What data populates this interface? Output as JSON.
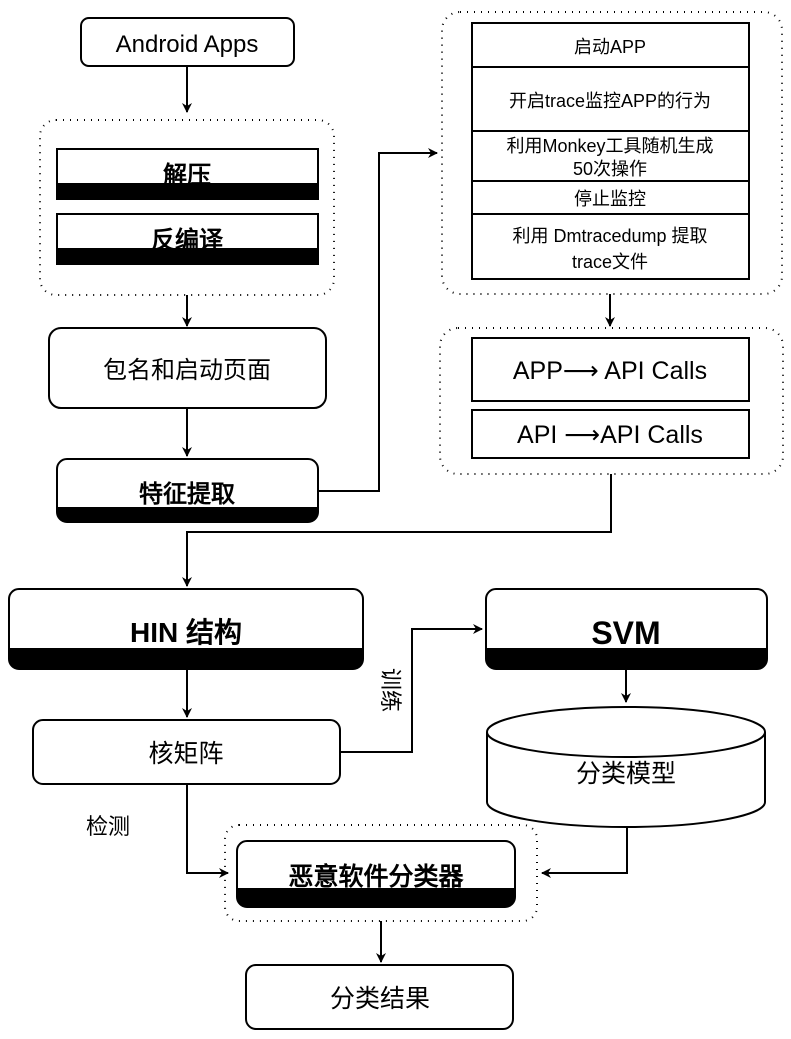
{
  "nodes": {
    "android_apps": "Android Apps",
    "unzip": "解压",
    "decompile": "反编译",
    "package_launch": "包名和启动页面",
    "feature_extract": "特征提取",
    "trace_steps": [
      [
        "启动APP"
      ],
      [
        "开启trace监控APP的行为"
      ],
      [
        "利用Monkey工具随机生成",
        "50次操作"
      ],
      [
        "停止监控"
      ],
      [
        "利用 Dmtracedump 提取",
        "trace文件"
      ]
    ],
    "app_api": "APP⟶ API Calls",
    "api_api": "API ⟶API Calls",
    "hin": "HIN 结构",
    "svm": "SVM",
    "kernel": "核矩阵",
    "model": "分类模型",
    "classifier": "恶意软件分类器",
    "result": "分类结果"
  },
  "labels": {
    "train": "训练",
    "detect": "检测"
  },
  "colors": {
    "stroke": "#000000",
    "fill": "#ffffff"
  }
}
